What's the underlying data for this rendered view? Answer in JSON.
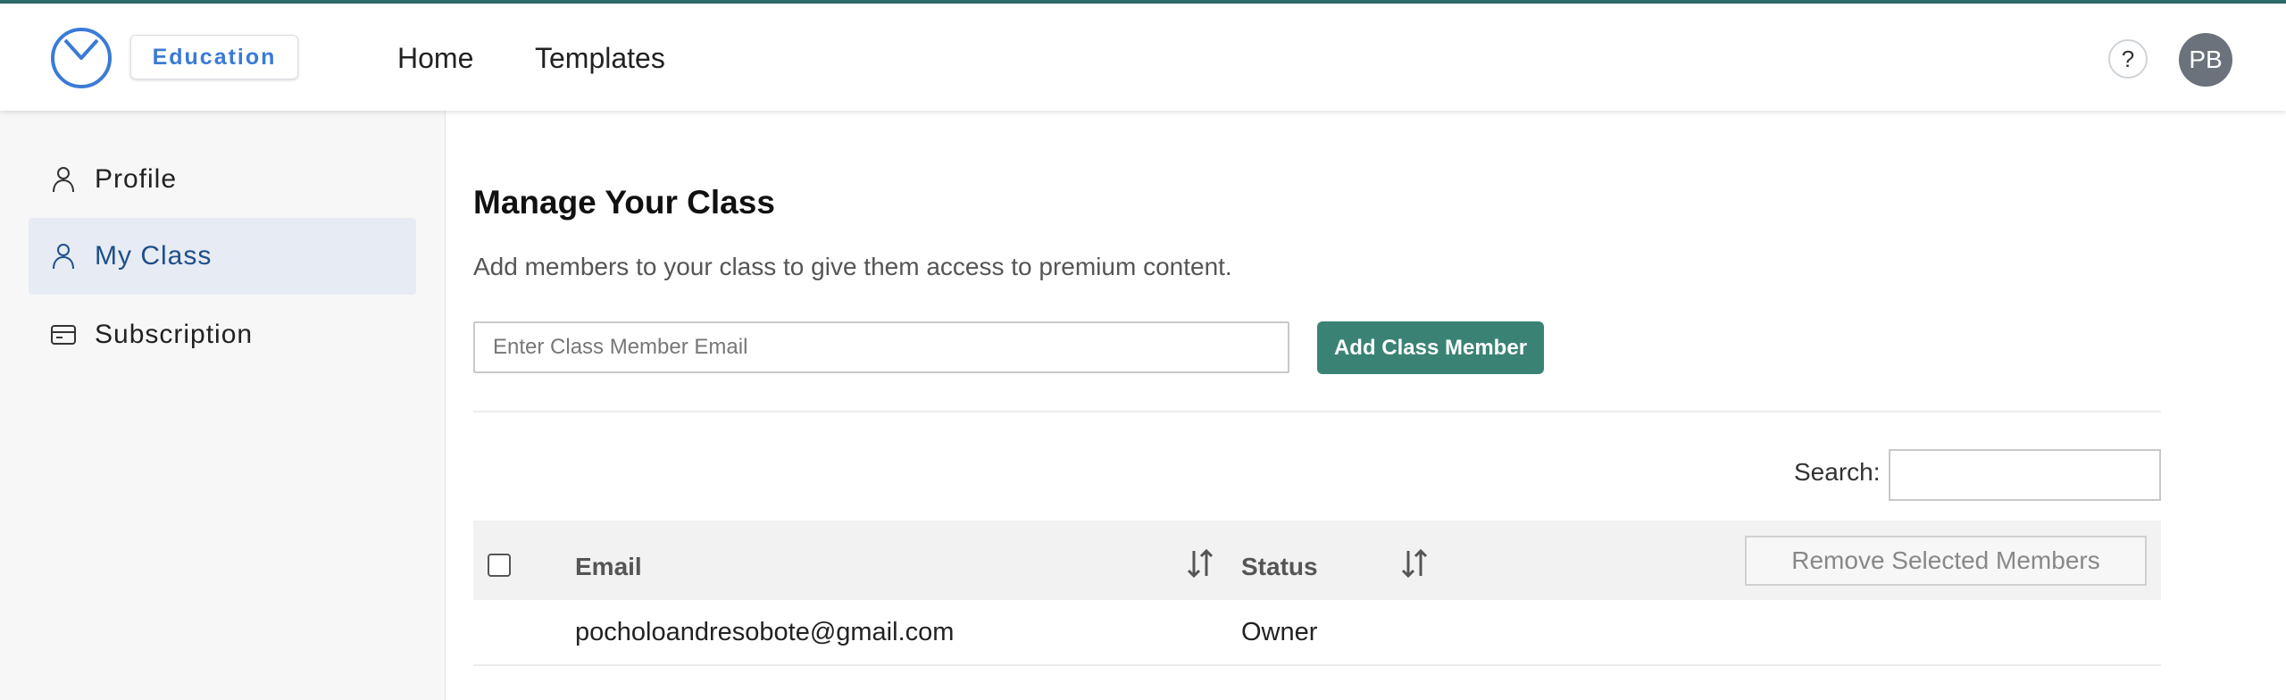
{
  "header": {
    "badge": "Education",
    "nav": [
      "Home",
      "Templates"
    ],
    "help_label": "?",
    "avatar_initials": "PB"
  },
  "sidebar": {
    "items": [
      {
        "label": "Profile",
        "icon": "person-icon",
        "active": false
      },
      {
        "label": "My Class",
        "icon": "person-icon",
        "active": true
      },
      {
        "label": "Subscription",
        "icon": "credit-card-icon",
        "active": false
      }
    ]
  },
  "main": {
    "title": "Manage Your Class",
    "subtitle": "Add members to your class to give them access to premium content.",
    "email_placeholder": "Enter Class Member Email",
    "add_button": "Add Class Member",
    "search_label": "Search:",
    "table": {
      "columns": [
        "Email",
        "Status"
      ],
      "remove_button": "Remove Selected Members",
      "rows": [
        {
          "email": "pocholoandresobote@gmail.com",
          "status": "Owner"
        }
      ]
    }
  },
  "colors": {
    "accent": "#3a8374",
    "brand_blue": "#3a7bd5",
    "top_line": "#2f6b68",
    "active_nav_bg": "#e7ebf3"
  }
}
